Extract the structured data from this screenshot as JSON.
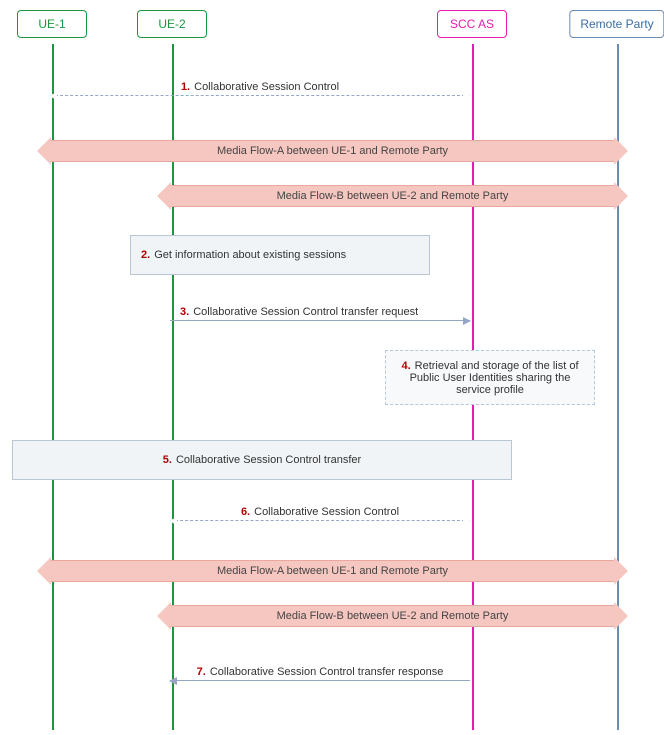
{
  "actors": {
    "ue1": "UE-1",
    "ue2": "UE-2",
    "scc": "SCC AS",
    "remote": "Remote Party"
  },
  "flows": {
    "a1": "Media Flow-A between UE-1 and Remote Party",
    "b1": "Media Flow-B between UE-2 and Remote Party",
    "a2": "Media Flow-A between UE-1 and Remote Party",
    "b2": "Media Flow-B between UE-2 and Remote Party"
  },
  "steps": {
    "s1": {
      "num": "1.",
      "text": "Collaborative Session Control"
    },
    "s2": {
      "num": "2.",
      "text": "Get information about existing sessions"
    },
    "s3": {
      "num": "3.",
      "text": "Collaborative Session Control transfer request"
    },
    "s4": {
      "num": "4.",
      "text": "Retrieval and storage of the list of Public User Identities sharing the service profile"
    },
    "s5": {
      "num": "5.",
      "text": "Collaborative Session Control transfer"
    },
    "s6": {
      "num": "6.",
      "text": "Collaborative Session Control"
    },
    "s7": {
      "num": "7.",
      "text": "Collaborative Session Control transfer response"
    }
  },
  "layout": {
    "x": {
      "ue1": 50,
      "ue2": 170,
      "scc": 470,
      "remote": 615
    }
  }
}
